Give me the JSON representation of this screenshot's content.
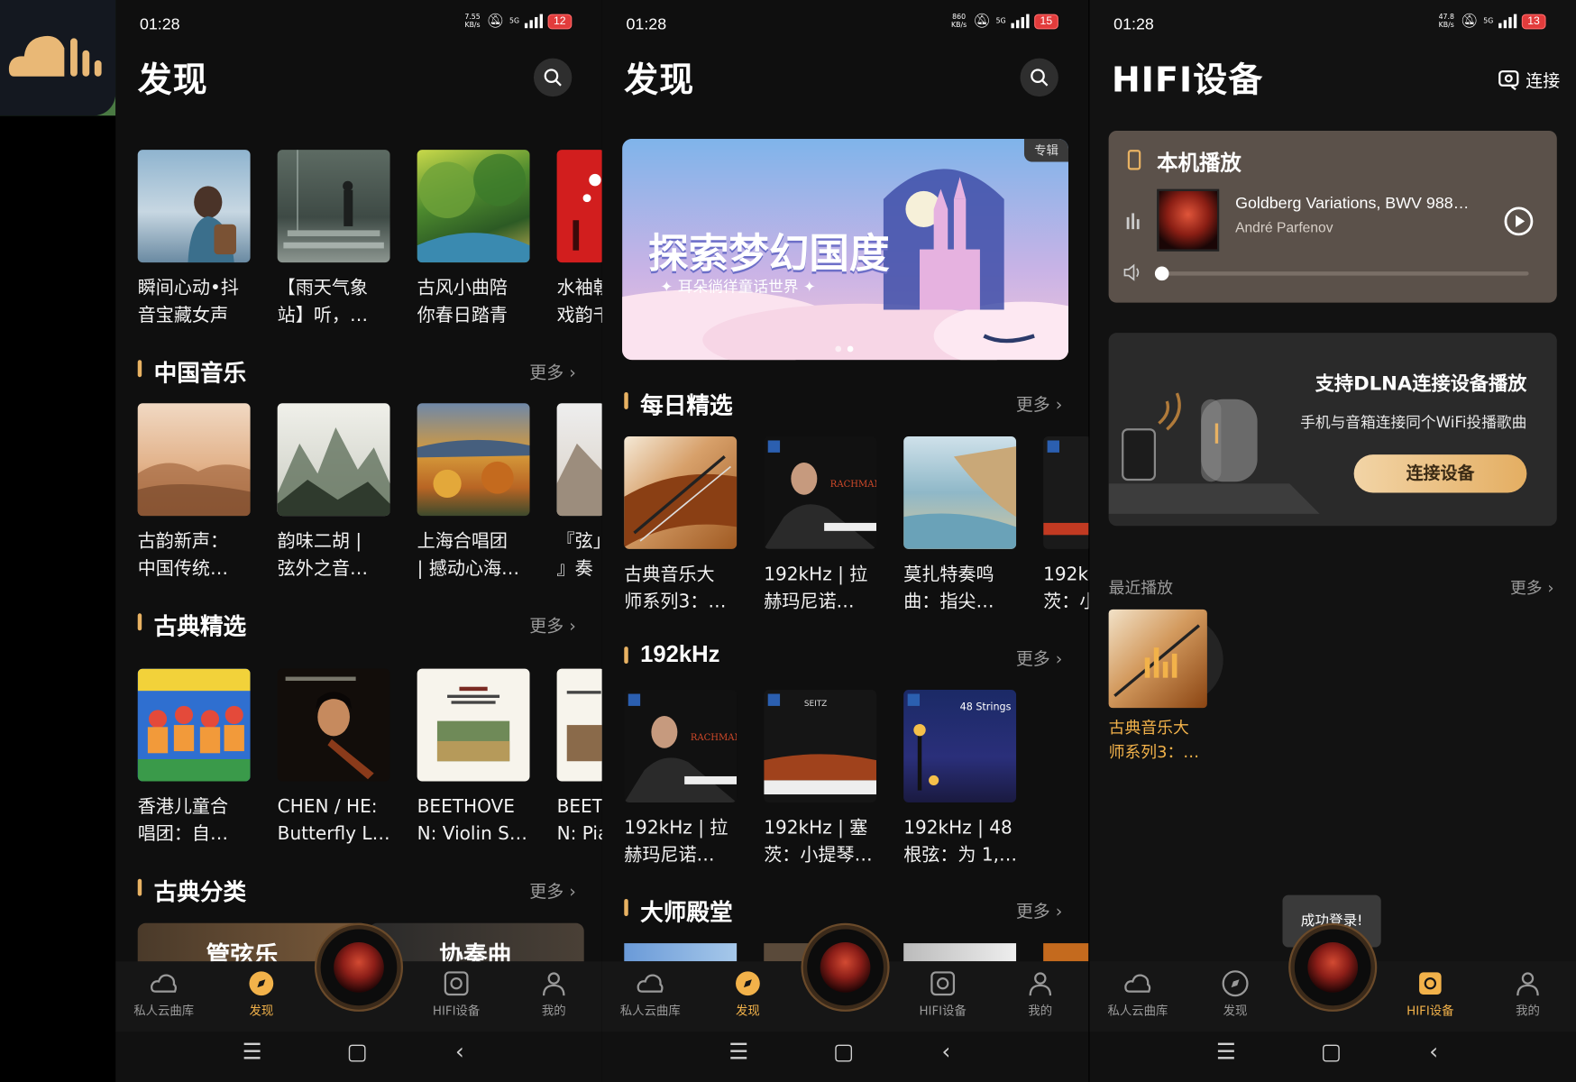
{
  "app_logo": {
    "icon": "cloud-bars-logo-icon"
  },
  "screens": [
    {
      "status": {
        "time": "01:28",
        "net_speed": "7.55\nKB/s",
        "network": "5G",
        "battery": "12"
      },
      "title": "发现",
      "top_row": [
        {
          "title": "瞬间心动•抖\n音宝藏女声"
        },
        {
          "title": "【雨天气象\n站】听，…"
        },
        {
          "title": "古风小曲陪\n你春日踏青"
        },
        {
          "title": "水袖朝\n戏韵千"
        }
      ],
      "sections": [
        {
          "title": "中国音乐",
          "more": "更多",
          "items": [
            {
              "title": "古韵新声：\n中国传统…"
            },
            {
              "title": "韵味二胡 |\n弦外之音…"
            },
            {
              "title": "上海合唱团\n| 撼动心海…"
            },
            {
              "title": "『弦」\n』奏"
            }
          ]
        },
        {
          "title": "古典精选",
          "more": "更多",
          "items": [
            {
              "title": "香港儿童合\n唱团：自…"
            },
            {
              "title": "CHEN / HE:\nButterfly L…"
            },
            {
              "title": "BEETHOVE\nN: Violin S…"
            },
            {
              "title": "BEET\nN: Pia"
            }
          ]
        },
        {
          "title": "古典分类",
          "more": "更多",
          "tiles": [
            "管弦乐",
            "协奏曲"
          ]
        }
      ],
      "nav": [
        "私人云曲库",
        "发现",
        "HIFI设备",
        "我的"
      ]
    },
    {
      "status": {
        "time": "01:28",
        "net_speed": "860\nKB/s",
        "network": "5G",
        "battery": "15"
      },
      "title": "发现",
      "banner": {
        "tag": "专辑",
        "headline": "探索梦幻国度",
        "sub": "✦ 耳朵徜徉童话世界 ✦"
      },
      "sections": [
        {
          "title": "每日精选",
          "more": "更多",
          "items": [
            {
              "title": "古典音乐大\n师系列3：…"
            },
            {
              "title": "192kHz | 拉\n赫玛尼诺…"
            },
            {
              "title": "莫扎特奏鸣\n曲：指尖…"
            },
            {
              "title": "192kHz\n茨：小"
            }
          ]
        },
        {
          "title": "192kHz",
          "more": "更多",
          "items": [
            {
              "title": "192kHz | 拉\n赫玛尼诺…"
            },
            {
              "title": "192kHz | 塞\n茨：小提琴…"
            },
            {
              "title": "192kHz | 48\n根弦：为 1,…"
            }
          ]
        },
        {
          "title": "大师殿堂",
          "more": "更多"
        }
      ],
      "nav": [
        "私人云曲库",
        "发现",
        "HIFI设备",
        "我的"
      ]
    },
    {
      "status": {
        "time": "01:28",
        "net_speed": "47.8\nKB/s",
        "network": "5G",
        "battery": "13"
      },
      "title": "HIFI设备",
      "connect_label": "连接",
      "local": {
        "title": "本机播放",
        "track": "Goldberg Variations, BWV 988…",
        "artist": "André Parfenov",
        "volume": 0
      },
      "dlna": {
        "title": "支持DLNA连接设备播放",
        "sub": "手机与音箱连接同个WiFi投播歌曲",
        "button": "连接设备"
      },
      "recent": {
        "title": "最近播放",
        "more": "更多",
        "item": "古典音乐大\n师系列3：…"
      },
      "toast": "成功登录!",
      "nav": [
        "私人云曲库",
        "发现",
        "HIFI设备",
        "我的"
      ]
    }
  ],
  "colors": {
    "accent": "#f2b24a",
    "card_bg": "#5b514a",
    "dlna_bg": "#2a2a2a"
  }
}
